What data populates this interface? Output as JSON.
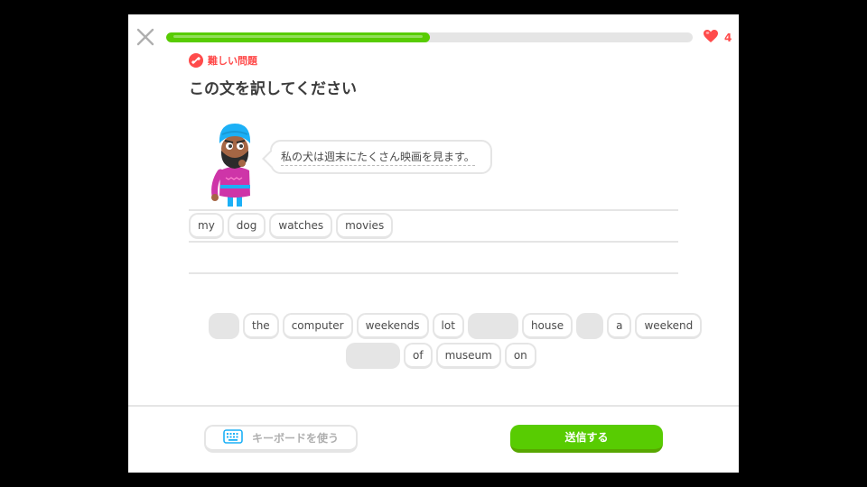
{
  "header": {
    "progress": 0.5,
    "hearts": "4"
  },
  "challenge": {
    "badge_label": "難しい問題",
    "instruction": "この文を訳してください",
    "prompt": "私の犬は週末にたくさん映画を見ます。"
  },
  "answer": {
    "words": [
      "my",
      "dog",
      "watches",
      "movies"
    ]
  },
  "word_bank": {
    "rows": [
      [
        "",
        "the",
        "computer",
        "weekends",
        "lot",
        "",
        "house",
        "",
        "a",
        "weekend"
      ],
      [
        "",
        "of",
        "museum",
        "on"
      ]
    ]
  },
  "footer": {
    "keyboard_label": "キーボードを使う",
    "submit_label": "送信する"
  },
  "colors": {
    "accent": "#58cc02",
    "danger": "#ff4b4b",
    "border": "#e5e5e5"
  }
}
